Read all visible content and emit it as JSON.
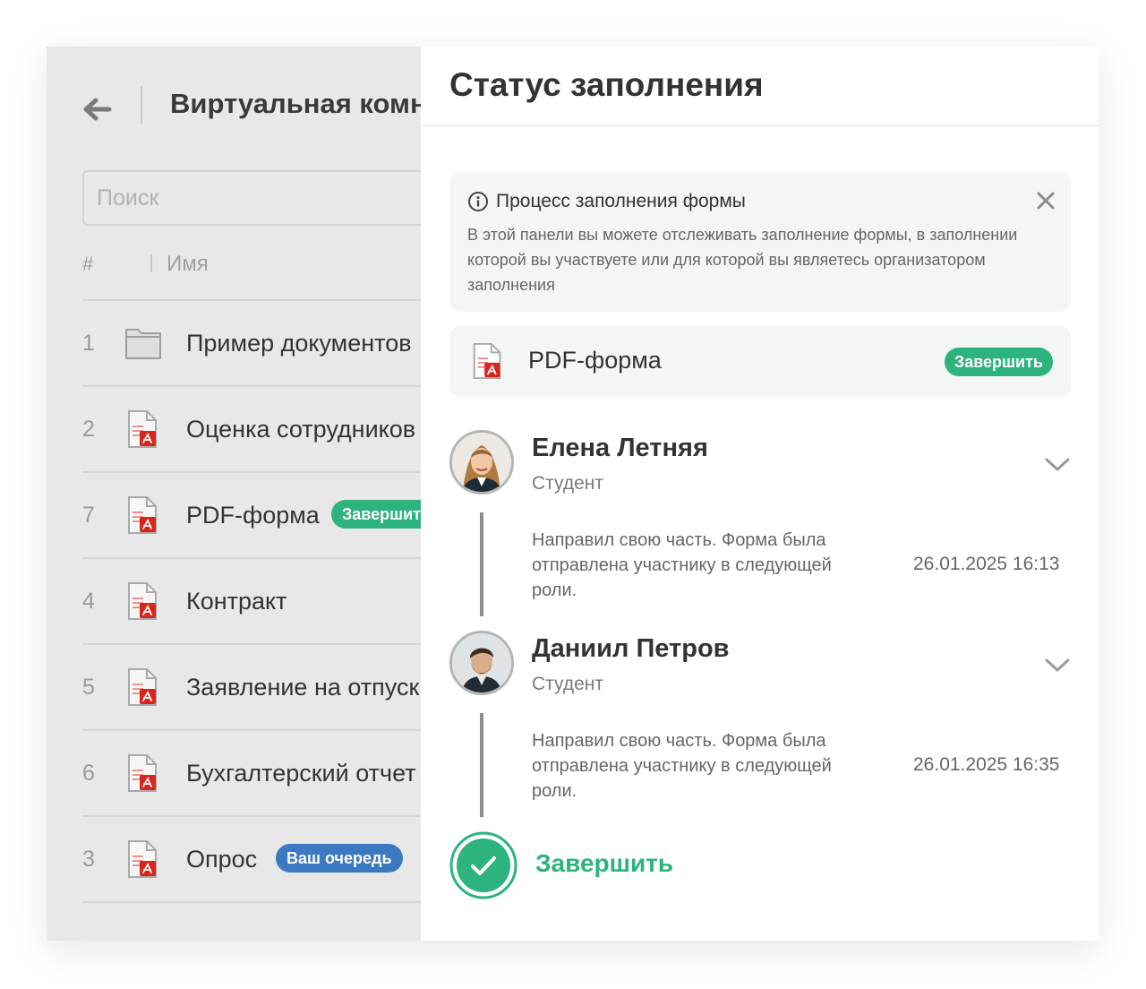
{
  "left": {
    "room_title": "Виртуальная комната",
    "search_placeholder": "Поиск",
    "col_hash": "#",
    "col_name": "Имя",
    "rows": [
      {
        "num": "1",
        "name": "Пример документов",
        "icon": "folder-icon"
      },
      {
        "num": "2",
        "name": "Оценка сотрудников",
        "icon": "pdf-file-icon"
      },
      {
        "num": "7",
        "name": "PDF-форма",
        "icon": "pdf-file-icon",
        "badge": "Завершить"
      },
      {
        "num": "4",
        "name": "Контракт",
        "icon": "pdf-file-icon"
      },
      {
        "num": "5",
        "name": "Заявление на отпуск",
        "icon": "pdf-file-icon"
      },
      {
        "num": "6",
        "name": "Бухгалтерский отчет",
        "icon": "pdf-file-icon"
      },
      {
        "num": "3",
        "name": "Опрос",
        "icon": "pdf-file-icon",
        "badge": "Ваш очередь"
      }
    ]
  },
  "panel": {
    "title": "Статус заполнения",
    "info": {
      "title": "Процесс заполнения формы",
      "text": "В этой панели вы можете отслеживать заполнение формы, в заполнении которой вы участвуете или для которой вы являетесь организатором заполнения"
    },
    "form": {
      "name": "PDF-форма",
      "badge": "Завершить"
    },
    "people": [
      {
        "name": "Елена Летняя",
        "role": "Студент",
        "note": "Направил свою часть. Форма была отправлена участнику в следующей роли.",
        "date": "26.01.2025 16:13"
      },
      {
        "name": "Даниил Петров",
        "role": "Студент",
        "note": "Направил свою часть. Форма была отправлена участнику в следующей роли.",
        "date": "26.01.2025 16:35"
      }
    ],
    "finish_label": "Завершить"
  },
  "colors": {
    "accent_green": "#2cb37e",
    "badge_blue": "#3b79c3",
    "pdf_red": "#d9261c",
    "overlay_gray": "#e8e8e8"
  }
}
